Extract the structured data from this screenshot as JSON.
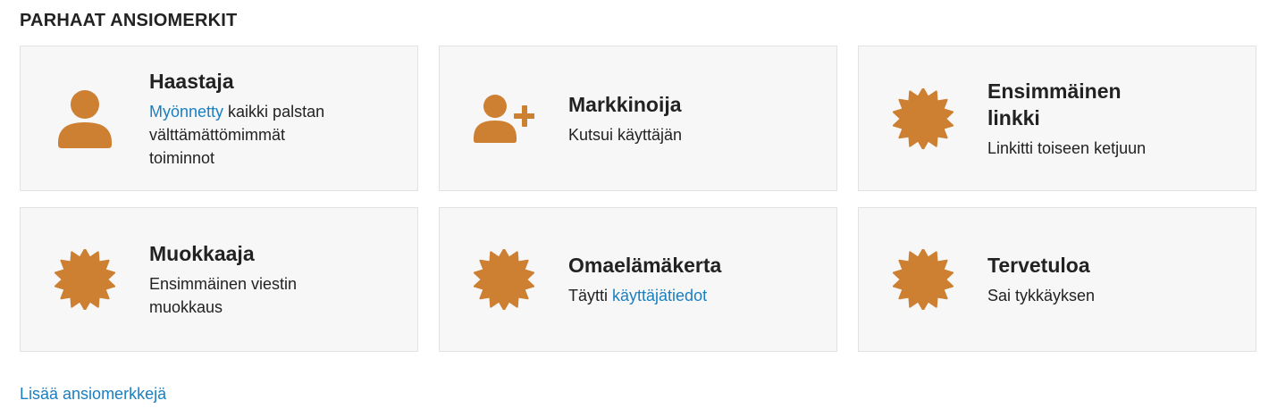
{
  "section": {
    "title": "PARHAAT ANSIOMERKIT"
  },
  "colors": {
    "badge_bronze": "#cd7f32",
    "link": "#1a7fc1",
    "card_bg": "#f7f7f7"
  },
  "badges": [
    {
      "name": "Haastaja",
      "icon": "user-icon",
      "desc_link": "Myönnetty",
      "desc_rest": " kaikki palstan välttämättömimmät toiminnot"
    },
    {
      "name": "Markkinoija",
      "icon": "user-plus-icon",
      "desc": "Kutsui käyttäjän"
    },
    {
      "name": "Ensimmäinen linkki",
      "icon": "badge-icon",
      "desc": "Linkitti toiseen ketjuun"
    },
    {
      "name": "Muokkaaja",
      "icon": "badge-icon",
      "desc": "Ensimmäinen viestin muokkaus"
    },
    {
      "name": "Omaelämäkerta",
      "icon": "badge-icon",
      "desc_prefix": "Täytti ",
      "desc_link": "käyttäjätiedot"
    },
    {
      "name": "Tervetuloa",
      "icon": "badge-icon",
      "desc": "Sai tykkäyksen"
    }
  ],
  "footer": {
    "more_link": "Lisää ansiomerkkejä"
  }
}
